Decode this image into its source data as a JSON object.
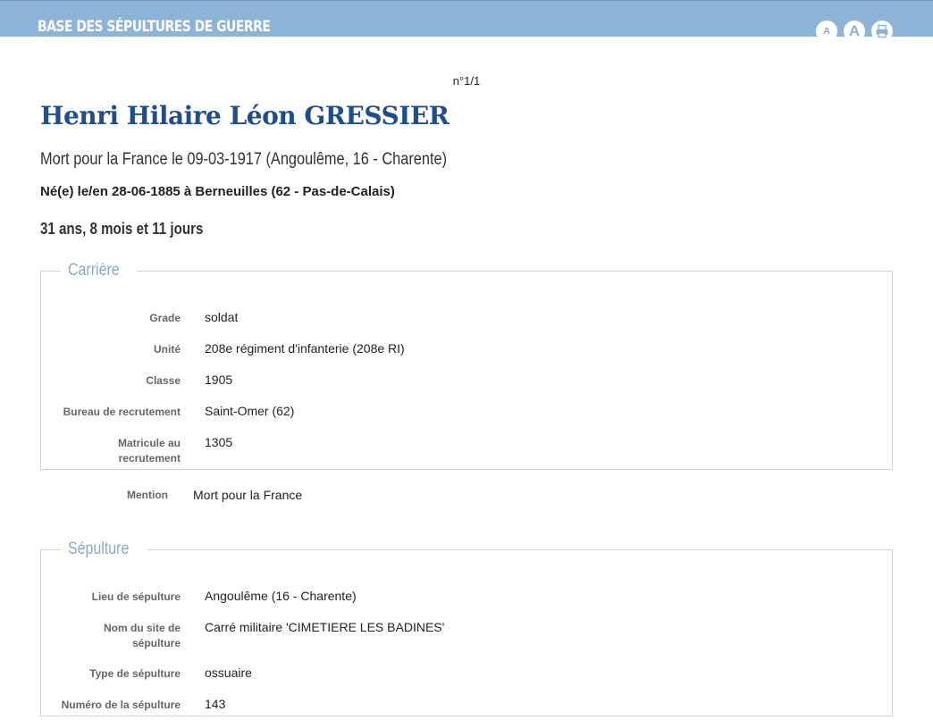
{
  "header": {
    "title": "Base des sépultures de guerre",
    "tools": [
      {
        "label": "A",
        "icon": "text-smaller-icon"
      },
      {
        "label": "A",
        "icon": "text-larger-icon"
      },
      {
        "label": "",
        "icon": "print-icon"
      }
    ]
  },
  "record": {
    "counter": "n°1/1",
    "name": "Henri Hilaire Léon GRESSIER",
    "death": "Mort pour la France le 09-03-1917 (Angoulême, 16 - Charente)",
    "birth": "Né(e) le/en 28-06-1885 à Berneuilles (62 - Pas-de-Calais)",
    "age": "31 ans, 8 mois et 11 jours"
  },
  "career": {
    "legend": "Carrière",
    "rows": [
      {
        "label": "Grade",
        "value": "soldat"
      },
      {
        "label": "Unité",
        "value": "208e régiment d'infanterie (208e RI)"
      },
      {
        "label": "Classe",
        "value": "1905"
      },
      {
        "label": "Bureau de recrutement",
        "value": "Saint-Omer (62)"
      },
      {
        "label": "Matricule au recrutement",
        "value": "1305"
      }
    ]
  },
  "mention": {
    "label": "Mention",
    "value": "Mort pour la France"
  },
  "burial": {
    "legend": "Sépulture",
    "rows": [
      {
        "label": "Lieu de sépulture",
        "value": "Angoulême (16 - Charente)"
      },
      {
        "label": "Nom du site de sépulture",
        "value": "Carré militaire 'CIMETIERE LES BADINES'"
      },
      {
        "label": "Type de sépulture",
        "value": "ossuaire"
      },
      {
        "label": "Numéro de la sépulture",
        "value": "143"
      }
    ]
  },
  "colors": {
    "header_bg": "#8db3d6",
    "name": "#1f4e8c",
    "legend": "#8aa9c6"
  }
}
